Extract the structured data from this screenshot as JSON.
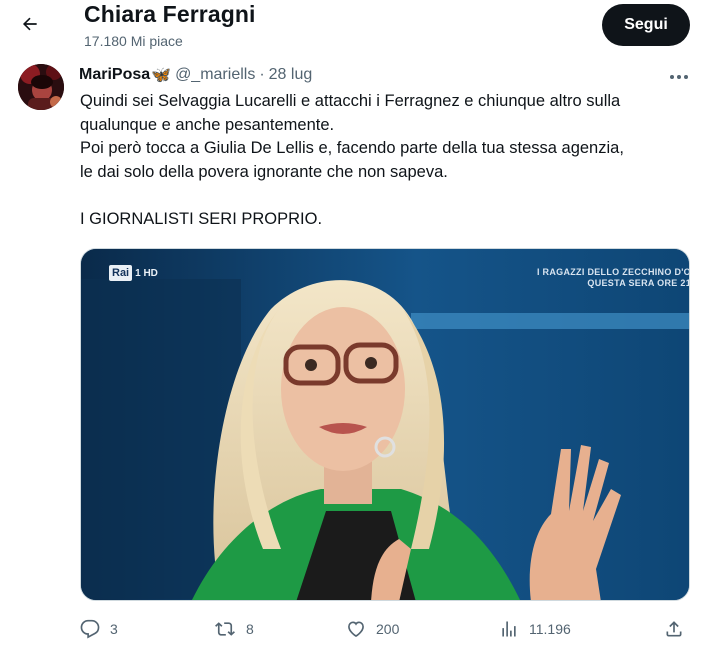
{
  "header": {
    "back_label": "Back",
    "title": "Chiara Ferragni",
    "subtitle": "17.180 Mi piace",
    "follow_label": "Segui"
  },
  "tweet": {
    "author_name": "MariPosa",
    "author_emoji": "🦋",
    "handle": "@_mariells",
    "separator": "·",
    "date": "28 lug",
    "text_lines": [
      "Quindi sei Selvaggia Lucarelli e attacchi i Ferragnez e chiunque altro sulla",
      "qualunque e anche pesantemente.",
      "Poi però tocca a Giulia De Lellis e, facendo parte della tua stessa agenzia,",
      "le dai solo della povera ignorante che non sapeva.",
      "",
      "I GIORNALISTI SERI PROPRIO."
    ],
    "media": {
      "channel_logo": "Rai",
      "channel_number": "1 HD",
      "promo_line_1": "I RAGAZZI DELLO ZECCHINO D'O",
      "promo_line_2": "QUESTA SERA ORE 21"
    },
    "actions": {
      "replies": "3",
      "reposts": "8",
      "likes": "200",
      "views": "11.196"
    }
  },
  "icons": {
    "back": "arrow-left-icon",
    "more": "more-horizontal-icon",
    "reply": "reply-icon",
    "repost": "repost-icon",
    "like": "heart-icon",
    "views": "views-icon",
    "share": "share-icon"
  },
  "colors": {
    "text_primary": "#0f1419",
    "text_secondary": "#536471",
    "follow_bg": "#0f1419",
    "follow_text": "#ffffff",
    "border": "#cfd9de"
  }
}
